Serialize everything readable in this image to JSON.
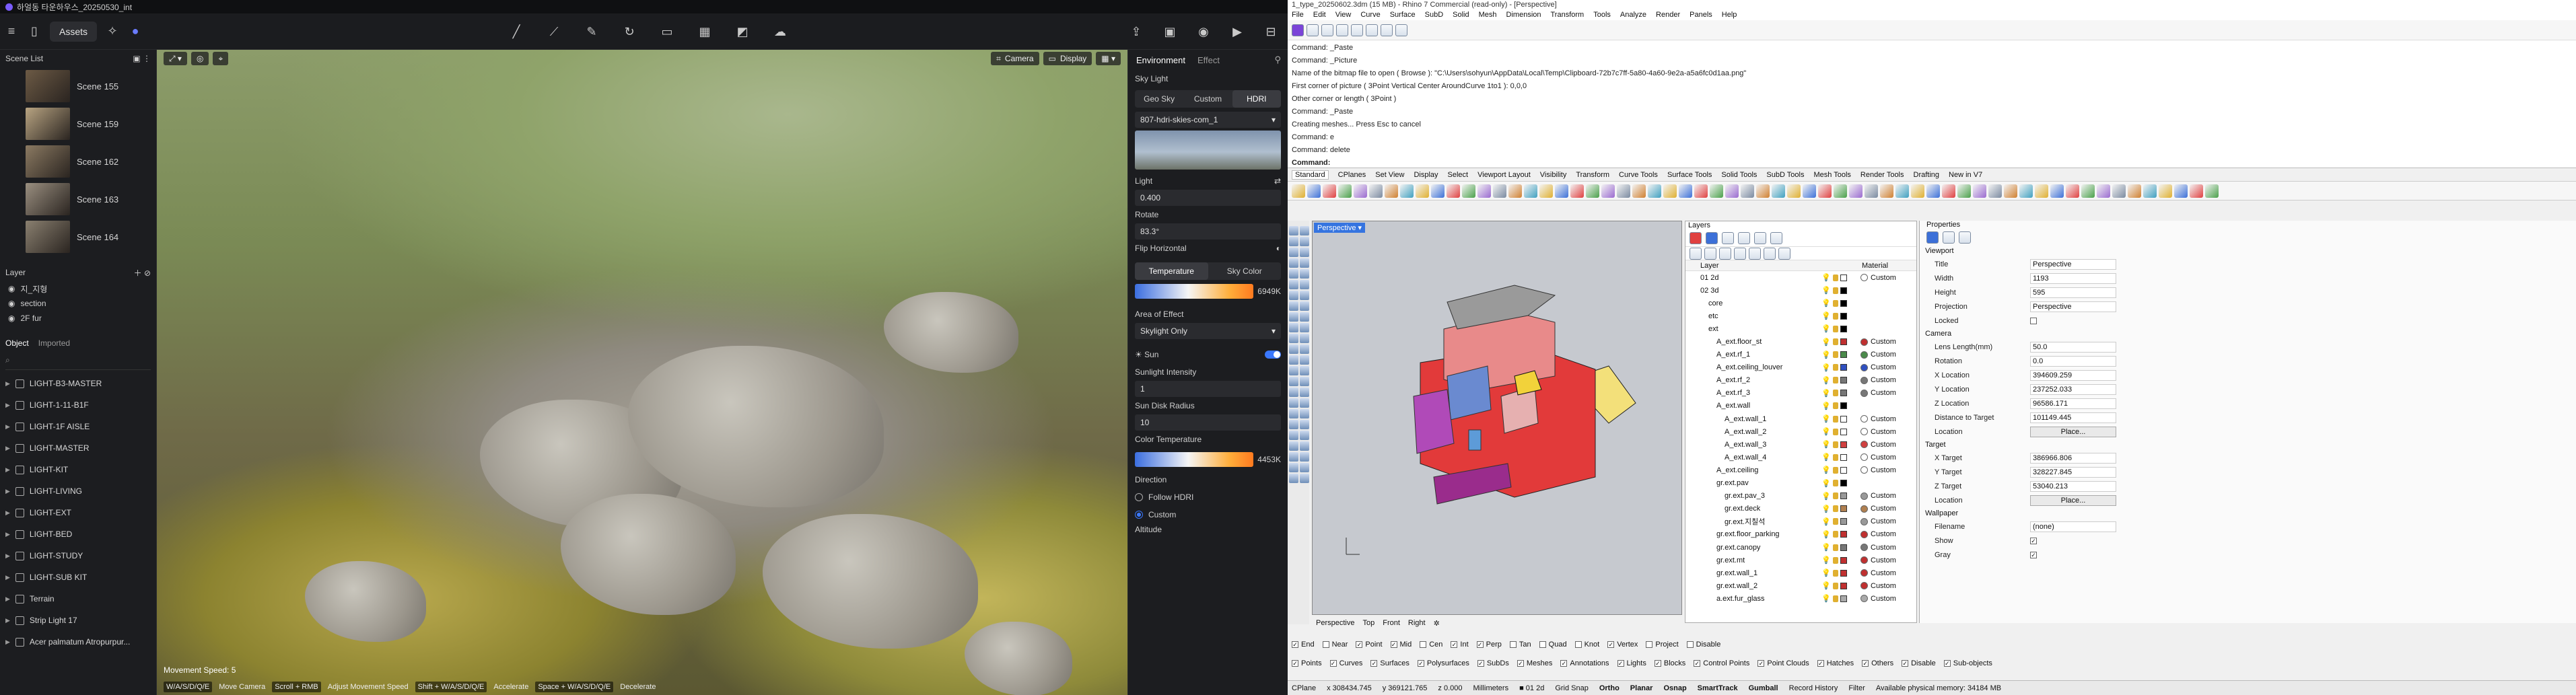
{
  "d5": {
    "title": "하얼동 타운하우스_20250530_int",
    "toolbar": {
      "assets_label": "Assets"
    },
    "scene_list": {
      "label": "Scene List",
      "scenes": [
        "Scene 155",
        "Scene 159",
        "Scene 162",
        "Scene 163",
        "Scene 164"
      ],
      "thumb_colors": [
        "#6c5a45",
        "#b8a482",
        "#8b7a62",
        "#9a8f80",
        "#8a8070"
      ]
    },
    "layer_panel": {
      "label": "Layer",
      "items": [
        "지_지형",
        "section",
        "2F fur"
      ]
    },
    "object_panel": {
      "tab_object": "Object",
      "tab_imported": "Imported",
      "items": [
        "LIGHT-B3-MASTER",
        "LIGHT-1-11-B1F",
        "LIGHT-1F AISLE",
        "LIGHT-MASTER",
        "LIGHT-KIT",
        "LIGHT-LIVING",
        "LIGHT-EXT",
        "LIGHT-BED",
        "LIGHT-STUDY",
        "LIGHT-SUB KIT",
        "Terrain",
        "Strip Light 17",
        "Acer palmatum Atropurpur..."
      ]
    },
    "viewport": {
      "camera_label": "Camera",
      "display_label": "Display",
      "movement_speed": "Movement Speed: 5",
      "hints": [
        "W/A/S/D/Q/E",
        "Move Camera",
        "Scroll + RMB",
        "Adjust Movement Speed",
        "Shift + W/A/S/D/Q/E",
        "Accelerate",
        "Space + W/A/S/D/Q/E",
        "Decelerate"
      ]
    },
    "env": {
      "tab_environment": "Environment",
      "tab_effect": "Effect",
      "sky_light": "Sky Light",
      "sky_modes": [
        "Geo Sky",
        "Custom",
        "HDRI"
      ],
      "hdri_name": "807-hdri-skies-com_1",
      "light_label": "Light",
      "light_value": "0.400",
      "rotate_label": "Rotate",
      "rotate_value": "83.3°",
      "flip_label": "Flip Horizontal",
      "temp_tab": "Temperature",
      "skycolor_tab": "Sky Color",
      "temp_value": "6949K",
      "area_label": "Area of Effect",
      "area_value": "Skylight Only",
      "sun_label": "Sun",
      "sun_intensity_label": "Sunlight Intensity",
      "sun_intensity_value": "1",
      "sun_disk_label": "Sun Disk Radius",
      "sun_disk_value": "10",
      "color_temp_label": "Color Temperature",
      "color_temp_value": "4453K",
      "direction_label": "Direction",
      "follow_hdri": "Follow HDRI",
      "custom_dir": "Custom",
      "altitude_label": "Altitude"
    }
  },
  "rhino": {
    "title": "1_type_20250602.3dm (15 MB) - Rhino 7 Commercial (read-only) - [Perspective]",
    "menu": [
      "File",
      "Edit",
      "View",
      "Curve",
      "Surface",
      "SubD",
      "Solid",
      "Mesh",
      "Dimension",
      "Transform",
      "Tools",
      "Analyze",
      "Render",
      "Panels",
      "Help"
    ],
    "command_history": [
      "Command: _Paste",
      "Command: _Picture",
      "Name of the bitmap file to open ( Browse ): \"C:\\Users\\sohyun\\AppData\\Local\\Temp\\Clipboard-72b7c7ff-5a80-4a60-9e2a-a5a6fc0d1aa.png\"",
      "First corner of picture ( 3Point  Vertical  Center  AroundCurve  1to1 ): 0,0,0",
      "Other corner or length ( 3Point )",
      "Command: _Paste",
      "Creating meshes... Press Esc to cancel",
      "Command: e",
      "Command: delete"
    ],
    "command_prompt": "Command:",
    "toolbar_tabs": [
      "Standard",
      "CPlanes",
      "Set View",
      "Display",
      "Select",
      "Viewport Layout",
      "Visibility",
      "Transform",
      "Curve Tools",
      "Surface Tools",
      "Solid Tools",
      "SubD Tools",
      "Mesh Tools",
      "Render Tools",
      "Drafting",
      "New in V7"
    ],
    "viewport_label": "Perspective",
    "viewport_tabs": [
      "Perspective",
      "Top",
      "Front",
      "Right"
    ],
    "osnaps": [
      "End",
      "Near",
      "Point",
      "Mid",
      "Cen",
      "Int",
      "Perp",
      "Tan",
      "Quad",
      "Knot",
      "Vertex",
      "Project",
      "Disable"
    ],
    "osnaps_on": [
      true,
      false,
      true,
      true,
      false,
      true,
      true,
      false,
      false,
      false,
      true,
      false,
      false
    ],
    "filters": [
      "Points",
      "Curves",
      "Surfaces",
      "Polysurfaces",
      "SubDs",
      "Meshes",
      "Annotations",
      "Lights",
      "Blocks",
      "Control Points",
      "Point Clouds",
      "Hatches",
      "Others",
      "Disable",
      "Sub-objects"
    ],
    "status": {
      "cplane": "CPlane",
      "x": "x 308434.745",
      "y": "y 369121.765",
      "z": "z 0.000",
      "units": "Millimeters",
      "layer": "01 2d",
      "grid_snap": "Grid Snap",
      "ortho": "Ortho",
      "planar": "Planar",
      "osnap": "Osnap",
      "smarttrack": "SmartTrack",
      "gumball": "Gumball",
      "record": "Record History",
      "filter": "Filter",
      "memory": "Available physical memory: 34184 MB"
    },
    "layers": {
      "title": "Layers",
      "col_layer": "Layer",
      "col_material": "Material",
      "rows": [
        {
          "name": "01 2d",
          "indent": 0,
          "mat": "Custom",
          "color": "#ffffff"
        },
        {
          "name": "02 3d",
          "indent": 0,
          "mat": "",
          "color": "#000000"
        },
        {
          "name": "core",
          "indent": 1,
          "mat": "",
          "color": "#000000"
        },
        {
          "name": "etc",
          "indent": 1,
          "mat": "",
          "color": "#000000"
        },
        {
          "name": "ext",
          "indent": 1,
          "mat": "",
          "color": "#000000"
        },
        {
          "name": "A_ext.floor_st",
          "indent": 2,
          "mat": "Custom",
          "color": "#c03030"
        },
        {
          "name": "A_ext.rf_1",
          "indent": 2,
          "mat": "Custom",
          "color": "#4a8a4a"
        },
        {
          "name": "A_ext.ceiling_louver",
          "indent": 2,
          "mat": "Custom",
          "color": "#3050c0"
        },
        {
          "name": "A_ext.rf_2",
          "indent": 2,
          "mat": "Custom",
          "color": "#777777"
        },
        {
          "name": "A_ext.rf_3",
          "indent": 2,
          "mat": "Custom",
          "color": "#777777"
        },
        {
          "name": "A_ext.wall",
          "indent": 2,
          "mat": "",
          "color": "#000000"
        },
        {
          "name": "A_ext.wall_1",
          "indent": 3,
          "mat": "Custom",
          "color": "#ffffff"
        },
        {
          "name": "A_ext.wall_2",
          "indent": 3,
          "mat": "Custom",
          "color": "#ffffff"
        },
        {
          "name": "A_ext.wall_3",
          "indent": 3,
          "mat": "Custom",
          "color": "#d04040"
        },
        {
          "name": "A_ext.wall_4",
          "indent": 3,
          "mat": "Custom",
          "color": "#ffffff"
        },
        {
          "name": "A_ext.ceiling",
          "indent": 2,
          "mat": "Custom",
          "color": "#ffffff"
        },
        {
          "name": "gr.ext.pav",
          "indent": 2,
          "mat": "",
          "color": "#000000"
        },
        {
          "name": "gr.ext.pav_3",
          "indent": 3,
          "mat": "Custom",
          "color": "#999999"
        },
        {
          "name": "gr.ext.deck",
          "indent": 3,
          "mat": "Custom",
          "color": "#b08050"
        },
        {
          "name": "gr.ext.지칠석",
          "indent": 3,
          "mat": "Custom",
          "color": "#999999"
        },
        {
          "name": "gr.ext.floor_parking",
          "indent": 2,
          "mat": "Custom",
          "color": "#c03030"
        },
        {
          "name": "gr.ext.canopy",
          "indent": 2,
          "mat": "Custom",
          "color": "#777777"
        },
        {
          "name": "gr.ext.mt",
          "indent": 2,
          "mat": "Custom",
          "color": "#c03030"
        },
        {
          "name": "gr.ext.wall_1",
          "indent": 2,
          "mat": "Custom",
          "color": "#c03030"
        },
        {
          "name": "gr.ext.wall_2",
          "indent": 2,
          "mat": "Custom",
          "color": "#c03030"
        },
        {
          "name": "a.ext.fur_glass",
          "indent": 2,
          "mat": "Custom",
          "color": "#aaaaaa"
        }
      ]
    },
    "properties": {
      "title": "Properties",
      "viewport_sec": "Viewport",
      "title_k": "Title",
      "title_v": "Perspective",
      "width_k": "Width",
      "width_v": "1193",
      "height_k": "Height",
      "height_v": "595",
      "projection_k": "Projection",
      "projection_v": "Perspective",
      "locked_k": "Locked",
      "camera_sec": "Camera",
      "lens_k": "Lens Length(mm)",
      "lens_v": "50.0",
      "rotation_k": "Rotation",
      "rotation_v": "0.0",
      "xloc_k": "X Location",
      "xloc_v": "394609.259",
      "yloc_k": "Y Location",
      "yloc_v": "237252.033",
      "zloc_k": "Z Location",
      "zloc_v": "96586.171",
      "dist_k": "Distance to Target",
      "dist_v": "101149.445",
      "location_k": "Location",
      "place_label": "Place...",
      "target_sec": "Target",
      "xt_k": "X Target",
      "xt_v": "386966.806",
      "yt_k": "Y Target",
      "yt_v": "328227.845",
      "zt_k": "Z Target",
      "zt_v": "53040.213",
      "wallpaper_sec": "Wallpaper",
      "filename_k": "Filename",
      "filename_v": "(none)",
      "show_k": "Show",
      "gray_k": "Gray"
    }
  }
}
